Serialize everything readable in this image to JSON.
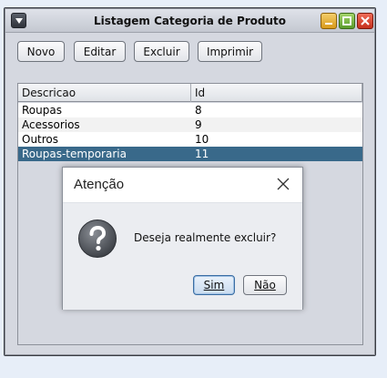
{
  "window": {
    "title": "Listagem Categoria de Produto"
  },
  "toolbar": {
    "novo": "Novo",
    "editar": "Editar",
    "excluir": "Excluir",
    "imprimir": "Imprimir"
  },
  "table": {
    "columns": [
      "Descricao",
      "Id"
    ],
    "rows": [
      {
        "descricao": "Roupas",
        "id": "8"
      },
      {
        "descricao": "Acessorios",
        "id": "9"
      },
      {
        "descricao": "Outros",
        "id": "10"
      },
      {
        "descricao": "Roupas-temporaria",
        "id": "11"
      }
    ],
    "selected_row": 3
  },
  "dialog": {
    "title": "Atenção",
    "message": "Deseja realmente excluir?",
    "yes_label": "Sim",
    "no_label": "Não",
    "icon": "question-icon"
  },
  "colors": {
    "selection": "#39698a",
    "frame_bg": "#d5d8e0",
    "page_bg": "#e7eef8"
  }
}
